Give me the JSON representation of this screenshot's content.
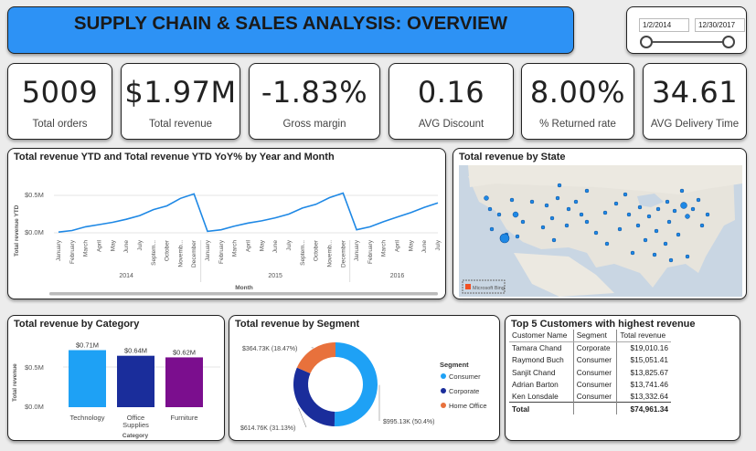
{
  "header": {
    "title": "SUPPLY CHAIN & SALES ANALYSIS: OVERVIEW"
  },
  "date_slicer": {
    "start": "1/2/2014",
    "end": "12/30/2017"
  },
  "kpis": [
    {
      "value": "5009",
      "label": "Total orders"
    },
    {
      "value": "$1.97M",
      "label": "Total revenue"
    },
    {
      "value": "-1.83%",
      "label": "Gross margin"
    },
    {
      "value": "0.16",
      "label": "AVG Discount"
    },
    {
      "value": "8.00%",
      "label": "% Returned rate"
    },
    {
      "value": "34.61",
      "label": "AVG Delivery Time"
    }
  ],
  "line_chart": {
    "title": "Total revenue YTD and Total revenue YTD YoY% by Year and Month",
    "ylabel": "Total revenue YTD",
    "xlabel": "Month",
    "yticks": [
      "$0.5M",
      "$0.0M"
    ],
    "months_full": [
      "January",
      "February",
      "March",
      "April",
      "May",
      "June",
      "July",
      "Septem...",
      "October",
      "Novemb...",
      "December"
    ],
    "months_2016": [
      "January",
      "February",
      "March",
      "April",
      "May",
      "June",
      "July"
    ],
    "years": [
      "2014",
      "2015",
      "2016"
    ]
  },
  "map": {
    "title": "Total revenue by State",
    "attribution": "Microsoft Bing"
  },
  "category_chart": {
    "title": "Total revenue by Category",
    "ylabel": "Total revenue",
    "xlabel": "Category",
    "yticks": [
      "$0.5M",
      "$0.0M"
    ]
  },
  "segment_chart": {
    "title": "Total revenue by Segment",
    "legend_title": "Segment"
  },
  "top5": {
    "title": "Top 5 Customers with highest revenue",
    "columns": [
      "Customer Name",
      "Segment",
      "Total revenue"
    ],
    "rows": [
      [
        "Tamara Chand",
        "Corporate",
        "$19,010.16"
      ],
      [
        "Raymond Buch",
        "Consumer",
        "$15,051.41"
      ],
      [
        "Sanjit Chand",
        "Consumer",
        "$13,825.67"
      ],
      [
        "Adrian Barton",
        "Consumer",
        "$13,741.46"
      ],
      [
        "Ken Lonsdale",
        "Consumer",
        "$13,332.64"
      ]
    ],
    "total_label": "Total",
    "total_value": "$74,961.34"
  },
  "chart_data": [
    {
      "type": "line",
      "title": "Total revenue YTD and Total revenue YTD YoY% by Year and Month",
      "ylabel": "Total revenue YTD",
      "xlabel": "Month",
      "ylim": [
        0,
        0.9
      ],
      "y_unit": "$M",
      "x": [
        "2014-Jan",
        "2014-Feb",
        "2014-Mar",
        "2014-Apr",
        "2014-May",
        "2014-Jun",
        "2014-Jul",
        "2014-Sep",
        "2014-Oct",
        "2014-Nov",
        "2014-Dec",
        "2015-Jan",
        "2015-Feb",
        "2015-Mar",
        "2015-Apr",
        "2015-May",
        "2015-Jun",
        "2015-Jul",
        "2015-Sep",
        "2015-Oct",
        "2015-Nov",
        "2015-Dec",
        "2016-Jan",
        "2016-Feb",
        "2016-Mar",
        "2016-Apr",
        "2016-May",
        "2016-Jun",
        "2016-Jul"
      ],
      "series": [
        {
          "values": [
            0.01,
            0.03,
            0.08,
            0.11,
            0.14,
            0.18,
            0.23,
            0.31,
            0.36,
            0.46,
            0.52,
            0.02,
            0.04,
            0.09,
            0.13,
            0.16,
            0.2,
            0.25,
            0.33,
            0.38,
            0.47,
            0.53,
            0.04,
            0.08,
            0.15,
            0.21,
            0.27,
            0.34,
            0.4
          ]
        }
      ],
      "color": "#1e88e5"
    },
    {
      "type": "bar",
      "title": "Total revenue by Category",
      "categories": [
        "Technology",
        "Office Supplies",
        "Furniture"
      ],
      "values": [
        0.71,
        0.64,
        0.62
      ],
      "data_labels": [
        "$0.71M",
        "$0.64M",
        "$0.62M"
      ],
      "colors": [
        "#1ea1f5",
        "#1a2d9b",
        "#7b0e8e"
      ],
      "ylabel": "Total revenue",
      "xlabel": "Category",
      "ylim": [
        0,
        0.75
      ]
    },
    {
      "type": "pie",
      "title": "Total revenue by Segment",
      "categories": [
        "Consumer",
        "Corporate",
        "Home Office"
      ],
      "values": [
        995.13,
        614.76,
        364.73
      ],
      "data_labels": [
        "$995.13K (50.4%)",
        "$614.76K (31.13%)",
        "$364.73K (18.47%)"
      ],
      "colors": [
        "#1ea1f5",
        "#1a2d9b",
        "#e8713c"
      ]
    }
  ]
}
